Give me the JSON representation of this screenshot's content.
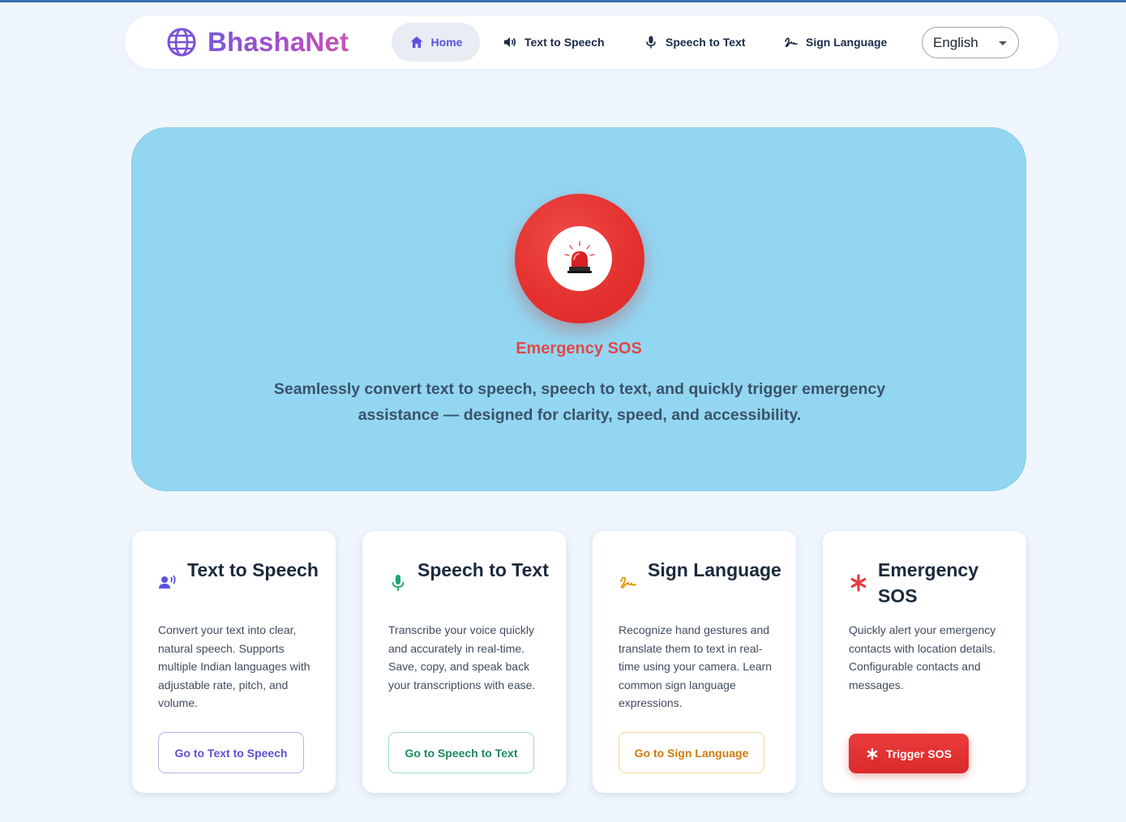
{
  "brand": {
    "name": "BhashaNet",
    "icon": "globe-icon"
  },
  "nav": {
    "home": "Home",
    "tts": "Text to Speech",
    "stt": "Speech to Text",
    "sign": "Sign Language"
  },
  "language": {
    "selected": "English"
  },
  "hero": {
    "title": "Emergency SOS",
    "description": "Seamlessly convert text to speech, speech to text, and quickly trigger emergency assistance — designed for clarity, speed, and accessibility."
  },
  "cards": [
    {
      "title": "Text to Speech",
      "text": "Convert your text into clear, natural speech. Supports multiple Indian languages with adjustable rate, pitch, and volume.",
      "button": "Go to Text to Speech",
      "icon": "speaking-person-icon"
    },
    {
      "title": "Speech to Text",
      "text": "Transcribe your voice quickly and accurately in real-time. Save, copy, and speak back your transcriptions with ease.",
      "button": "Go to Speech to Text",
      "icon": "microphone-icon"
    },
    {
      "title": "Sign Language",
      "text": "Recognize hand gestures and translate them to text in real-time using your camera. Learn common sign language expressions.",
      "button": "Go to Sign Language",
      "icon": "signature-icon"
    },
    {
      "title": "Emergency SOS",
      "text": "Quickly alert your emergency contacts with location details. Configurable contacts and messages.",
      "button": "Trigger SOS",
      "icon": "asterisk-icon"
    }
  ],
  "colors": {
    "accent": "#5b51e0",
    "sos": "#e14848",
    "hero_bg": "#93d6f2",
    "page_bg": "#eff6fd"
  }
}
